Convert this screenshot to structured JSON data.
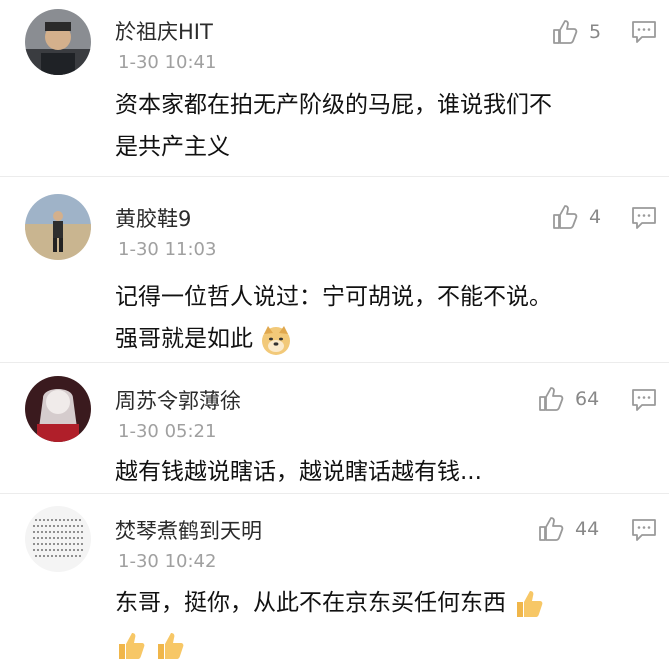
{
  "comments": [
    {
      "name": "於祖庆HIT",
      "time": "1-30 10:41",
      "likes": "5",
      "lines": [
        "资本家都在拍无产阶级的马屁，谁说我们不",
        "是共产主义"
      ]
    },
    {
      "name": "黄胶鞋9",
      "time": "1-30 11:03",
      "likes": "4",
      "lines": [
        "记得一位哲人说过：宁可胡说，不能不说。",
        "强哥就是如此"
      ]
    },
    {
      "name": "周苏令郭薄徐",
      "time": "1-30 05:21",
      "likes": "64",
      "lines": [
        "越有钱越说瞎话，越说瞎话越有钱..."
      ]
    },
    {
      "name": "焚琴煮鹤到天明",
      "time": "1-30 10:42",
      "likes": "44",
      "lines": [
        "东哥，挺你，从此不在京东买任何东西"
      ]
    }
  ],
  "icons": {
    "like": "thumbs-up-outline-icon",
    "reply": "comment-reply-icon",
    "emoji_doge": "doge-emoji",
    "emoji_thumb": "thumbs-up-emoji"
  }
}
